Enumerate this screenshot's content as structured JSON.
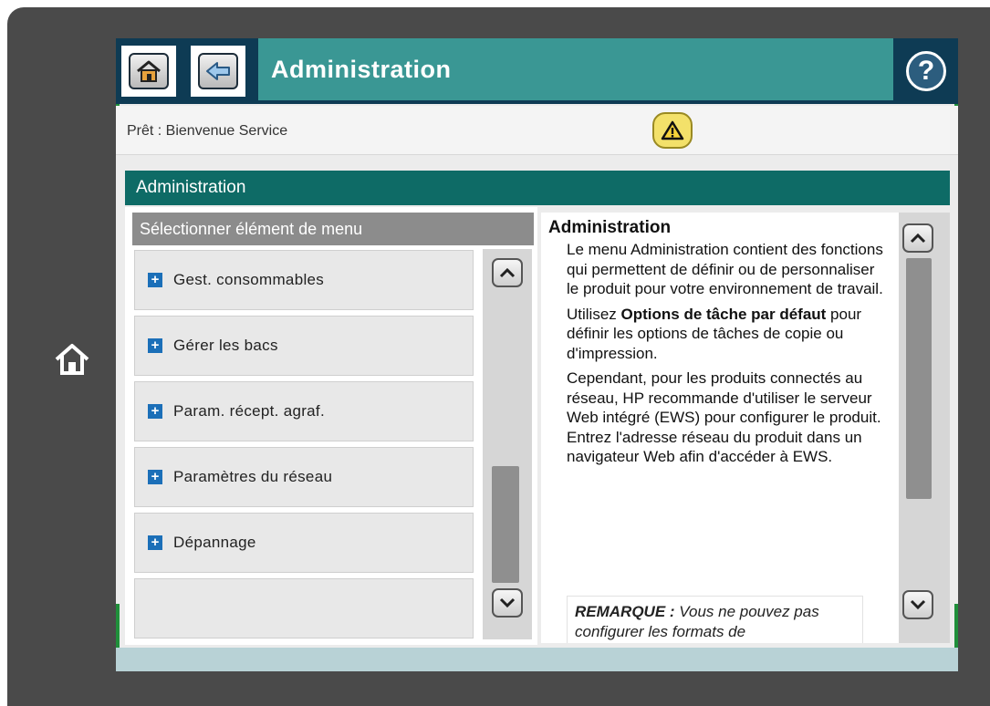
{
  "device": {
    "home_icon": "home-icon"
  },
  "header": {
    "home_icon": "home-icon",
    "back_icon": "back-arrow-icon",
    "title": "Administration",
    "help_label": "?",
    "help_icon": "help-icon"
  },
  "status": {
    "text": "Prêt : Bienvenue Service",
    "warning_icon": "warning-icon"
  },
  "panel": {
    "title": "Administration"
  },
  "menu": {
    "header": "Sélectionner élément de menu",
    "items": [
      {
        "label": "Gest. consommables",
        "icon": "expand-plus-icon"
      },
      {
        "label": "Gérer les bacs",
        "icon": "expand-plus-icon"
      },
      {
        "label": "Param. récept. agraf.",
        "icon": "expand-plus-icon"
      },
      {
        "label": "Paramètres du réseau",
        "icon": "expand-plus-icon"
      },
      {
        "label": "Dépannage",
        "icon": "expand-plus-icon"
      }
    ],
    "scroll_up_icon": "chevron-up-icon",
    "scroll_down_icon": "chevron-down-icon"
  },
  "help": {
    "title": "Administration",
    "p1": "Le menu Administration contient des fonctions qui permettent de définir ou de personnaliser le produit pour votre environnement de travail.",
    "p2_prefix": "Utilisez ",
    "p2_bold": "Options de tâche par défaut",
    "p2_suffix": " pour définir les options de tâches de copie ou d'impression.",
    "p3": "Cependant, pour les produits connectés au réseau, HP recommande d'utiliser le serveur Web intégré (EWS) pour configurer le produit. Entrez l'adresse réseau du produit dans un navigateur Web afin d'accéder à EWS.",
    "remark_label": "REMARQUE :",
    "remark_text": " Vous ne pouvez pas configurer les formats de",
    "scroll_up_icon": "chevron-up-icon",
    "scroll_down_icon": "chevron-down-icon"
  },
  "colors": {
    "title_bar": "#3a9794",
    "panel_head": "#0e6b66",
    "top_frame": "#0e3b54",
    "list_head": "#8c8c8c",
    "plus_icon": "#1b6fb8"
  }
}
